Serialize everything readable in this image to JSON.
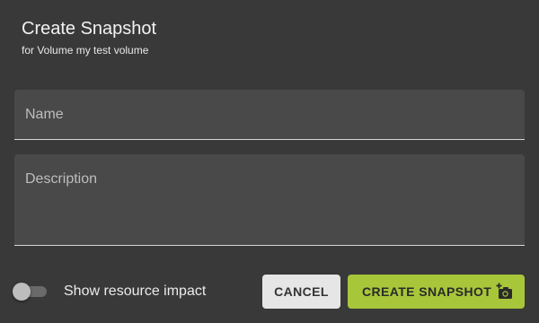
{
  "dialog": {
    "title": "Create Snapshot",
    "subtitle": "for Volume my test volume"
  },
  "form": {
    "name": {
      "value": "",
      "placeholder": "Name"
    },
    "description": {
      "value": "",
      "placeholder": "Description"
    }
  },
  "footer": {
    "toggle_label": "Show resource impact",
    "toggle_on": false,
    "cancel_label": "CANCEL",
    "create_label": "CREATE SNAPSHOT",
    "create_icon": "camera-add-icon"
  },
  "colors": {
    "background": "#393939",
    "field_background": "#494949",
    "accent": "#a8c63a",
    "cancel_button": "#e6e6e6"
  }
}
